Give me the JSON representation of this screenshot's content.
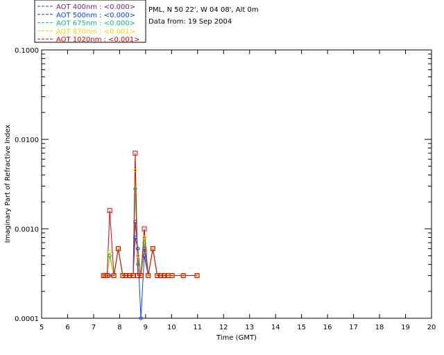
{
  "info": {
    "location": "PML, N 50 22', W 04 08', Alt 0m",
    "date_line": "Data from: 19 Sep 2004"
  },
  "chart_data": {
    "type": "line",
    "title": "",
    "xlabel": "Time (GMT)",
    "ylabel": "Imaginary Part of Refractive Index",
    "xlim": [
      5,
      20
    ],
    "ylim": [
      0.0001,
      0.1
    ],
    "y_scale": "log",
    "grid": false,
    "legend_position": "top-left",
    "x_ticks": [
      "5",
      "6",
      "7",
      "8",
      "9",
      "10",
      "11",
      "12",
      "13",
      "14",
      "15",
      "16",
      "17",
      "18",
      "19",
      "20"
    ],
    "y_ticks": [
      {
        "value": 0.0001,
        "label": "0.0001"
      },
      {
        "value": 0.001,
        "label": "0.0010"
      },
      {
        "value": 0.01,
        "label": "0.0100"
      },
      {
        "value": 0.1,
        "label": "0.1000"
      }
    ],
    "x": [
      7.38,
      7.45,
      7.52,
      7.62,
      7.78,
      7.95,
      8.12,
      8.25,
      8.38,
      8.52,
      8.6,
      8.7,
      8.82,
      8.95,
      9.1,
      9.28,
      9.45,
      9.58,
      9.72,
      9.86,
      10.02,
      10.45,
      10.98
    ],
    "series": [
      {
        "name": "AOT 400nm : <0.000>",
        "color": "#6b238e",
        "marker": "circle",
        "values": [
          0.0003,
          0.0003,
          0.0003,
          0.0003,
          0.0003,
          0.0006,
          0.0003,
          0.0003,
          0.0003,
          0.0003,
          0.0012,
          0.0006,
          0.0003,
          0.0006,
          0.0003,
          0.0006,
          0.0003,
          0.0003,
          0.0003,
          0.0003,
          0.0003,
          0.0003,
          0.0003
        ]
      },
      {
        "name": "AOT 500nm : <0.000>",
        "color": "#0044ff",
        "marker": "circle",
        "values": [
          0.0003,
          0.0003,
          0.0003,
          0.0003,
          0.0003,
          0.0006,
          0.0003,
          0.0003,
          0.0003,
          0.0003,
          0.0008,
          0.0006,
          0.0001,
          0.0005,
          0.0003,
          0.0006,
          0.0003,
          0.0003,
          0.0003,
          0.0003,
          0.0003,
          0.0003,
          0.0003
        ]
      },
      {
        "name": "AOT 675nm : <0.000>",
        "color": "#00c078",
        "marker": "circle",
        "values": [
          0.0003,
          0.0003,
          0.0003,
          0.0005,
          0.0003,
          0.0006,
          0.0003,
          0.0003,
          0.0003,
          0.0003,
          0.0028,
          0.0004,
          0.0003,
          0.0007,
          0.0003,
          0.0006,
          0.0003,
          0.0003,
          0.0003,
          0.0003,
          0.0003,
          0.0003,
          0.0003
        ]
      },
      {
        "name": "AOT 870nm : <0.001>",
        "color": "#e8d800",
        "marker": "circle",
        "values": [
          0.0003,
          0.0003,
          0.0003,
          0.00055,
          0.0003,
          0.0006,
          0.0003,
          0.0003,
          0.0003,
          0.0003,
          0.0045,
          0.0005,
          0.0003,
          0.0008,
          0.0003,
          0.0006,
          0.0003,
          0.0003,
          0.0003,
          0.0003,
          0.0003,
          0.0003,
          0.0003
        ]
      },
      {
        "name": "AOT 1020nm : <0.001>",
        "color": "#e00000",
        "marker": "square",
        "values": [
          0.0003,
          0.0003,
          0.0003,
          0.0016,
          0.0003,
          0.0006,
          0.0003,
          0.0003,
          0.0003,
          0.0003,
          0.007,
          0.0003,
          0.0003,
          0.001,
          0.0003,
          0.0006,
          0.0003,
          0.0003,
          0.0003,
          0.0003,
          0.0003,
          0.0003,
          0.0003
        ]
      }
    ]
  }
}
